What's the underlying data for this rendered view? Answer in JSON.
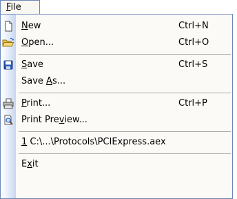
{
  "menu": {
    "title_pre": "",
    "title_ul": "F",
    "title_post": "ile"
  },
  "items": {
    "new": {
      "pre": "",
      "ul": "N",
      "post": "ew",
      "shortcut": "Ctrl+N",
      "icon": "new-document-icon"
    },
    "open": {
      "pre": "",
      "ul": "O",
      "post": "pen...",
      "shortcut": "Ctrl+O",
      "icon": "open-folder-icon"
    },
    "save": {
      "pre": "",
      "ul": "S",
      "post": "ave",
      "shortcut": "Ctrl+S",
      "icon": "save-disk-icon"
    },
    "save_as": {
      "pre": "Save ",
      "ul": "A",
      "post": "s..."
    },
    "print": {
      "pre": "",
      "ul": "P",
      "post": "rint...",
      "shortcut": "Ctrl+P",
      "icon": "printer-icon"
    },
    "print_preview": {
      "pre": "Print Pre",
      "ul": "v",
      "post": "iew...",
      "icon": "print-preview-icon"
    },
    "recent1": {
      "pre": "",
      "ul": "1",
      "post": " C:\\...\\Protocols\\PCIExpress.aex"
    },
    "exit": {
      "pre": "E",
      "ul": "x",
      "post": "it"
    }
  }
}
